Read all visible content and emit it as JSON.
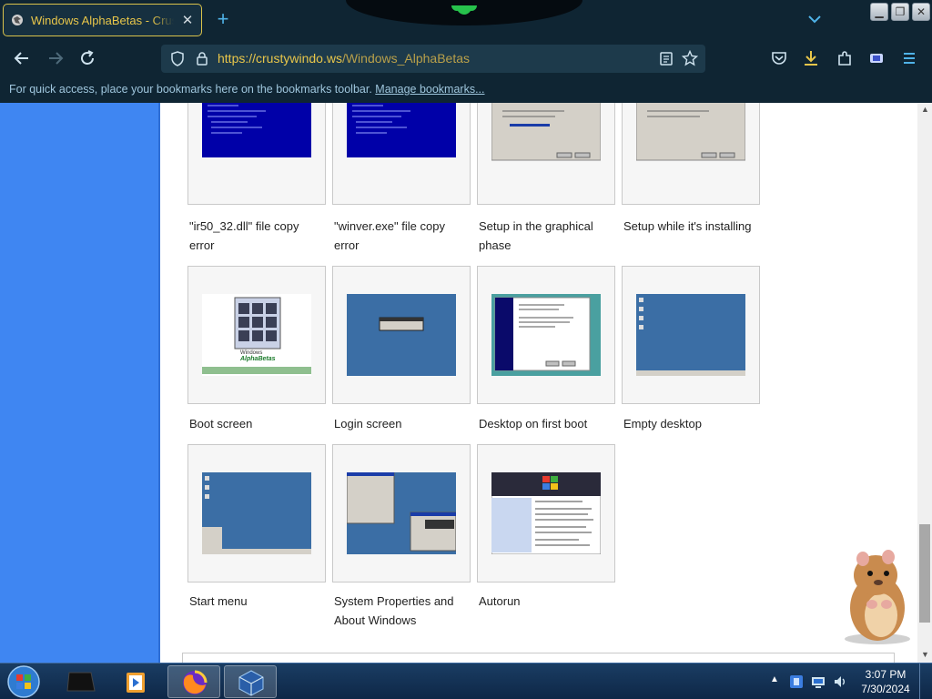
{
  "browser": {
    "tab": {
      "title": "Windows AlphaBetas - CrustyWindo.ws"
    },
    "url": {
      "host": "https://crustywindo.ws",
      "path": "/Windows_AlphaBetas"
    },
    "bookmarks_bar": {
      "message": "For quick access, place your bookmarks here on the bookmarks toolbar.",
      "link": "Manage bookmarks..."
    },
    "icons": [
      "firefox-favicon",
      "close-tab-icon",
      "new-tab-icon",
      "tab-list-icon",
      "back-icon",
      "forward-icon",
      "reload-icon",
      "tracking-protection-icon",
      "lock-icon",
      "reader-view-icon",
      "bookmark-star-icon",
      "pocket-icon",
      "downloads-icon",
      "extensions-icon",
      "container-icon",
      "menu-icon"
    ],
    "accent_color": "#e8c64a"
  },
  "gallery": {
    "items": [
      {
        "caption": "\"ir50_32.dll\" file copy error"
      },
      {
        "caption": "\"winver.exe\" file copy error"
      },
      {
        "caption": "Setup in the graphical phase"
      },
      {
        "caption": "Setup while it's installing"
      },
      {
        "caption": "Boot screen"
      },
      {
        "caption": "Login screen"
      },
      {
        "caption": "Desktop on first boot"
      },
      {
        "caption": "Empty desktop"
      },
      {
        "caption": "Start menu"
      },
      {
        "caption": "System Properties and About Windows"
      },
      {
        "caption": "Autorun"
      }
    ],
    "left_rail_color": "#3f86f2"
  },
  "taskbar": {
    "clock": {
      "time": "3:07 PM",
      "date": "7/30/2024"
    },
    "apps": [
      "explorer-icon",
      "media-player-icon",
      "firefox-icon",
      "virtualbox-icon"
    ]
  }
}
